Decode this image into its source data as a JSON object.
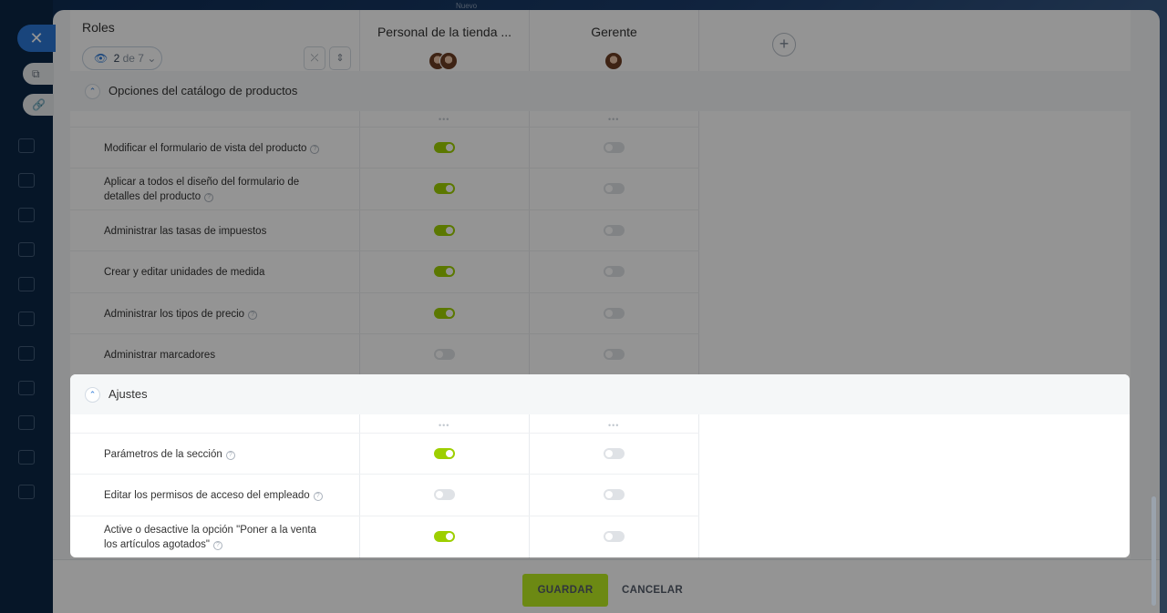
{
  "top_hint": "Nuevo",
  "rail": {
    "close_glyph": "✕",
    "tab1_glyph": "⧉",
    "tab2_glyph": "🔗"
  },
  "header": {
    "roles_label": "Roles",
    "counter_current": "2",
    "counter_of": "de 7",
    "collapse_glyph": "⤫",
    "sort_glyph": "⇕",
    "columns": [
      {
        "title": "Personal de la tienda ...",
        "avatar_count": 2
      },
      {
        "title": "Gerente",
        "avatar_count": 1
      }
    ],
    "add_glyph": "+"
  },
  "sections": [
    {
      "title": "Opciones del catálogo de productos",
      "rows": [
        {
          "label": "Modificar el formulario de vista del producto",
          "help": true,
          "col1_on": true,
          "col2_on": false
        },
        {
          "label": "Aplicar a todos el diseño del formulario de detalles del producto",
          "help": true,
          "col1_on": true,
          "col2_on": false
        },
        {
          "label": "Administrar las tasas de impuestos",
          "help": false,
          "col1_on": true,
          "col2_on": false
        },
        {
          "label": "Crear y editar unidades de medida",
          "help": false,
          "col1_on": true,
          "col2_on": false
        },
        {
          "label": "Administrar los tipos de precio",
          "help": true,
          "col1_on": true,
          "col2_on": false
        },
        {
          "label": "Administrar marcadores",
          "help": false,
          "col1_on": false,
          "col2_on": false
        }
      ]
    },
    {
      "title": "Ajustes",
      "rows": [
        {
          "label": "Parámetros de la sección",
          "help": true,
          "col1_on": true,
          "col2_on": false
        },
        {
          "label": "Editar los permisos de acceso del empleado",
          "help": true,
          "col1_on": false,
          "col2_on": false
        },
        {
          "label": "Active o desactive la opción \"Poner a la venta los artículos agotados\"",
          "help": true,
          "col1_on": true,
          "col2_on": false
        }
      ]
    }
  ],
  "footer": {
    "save_label": "GUARDAR",
    "cancel_label": "CANCELAR"
  },
  "colors": {
    "toggle_on": "#9dcf00",
    "toggle_off": "#dfe2e6",
    "save_button": "#bbed21",
    "accent_blue": "#2b78d6"
  }
}
